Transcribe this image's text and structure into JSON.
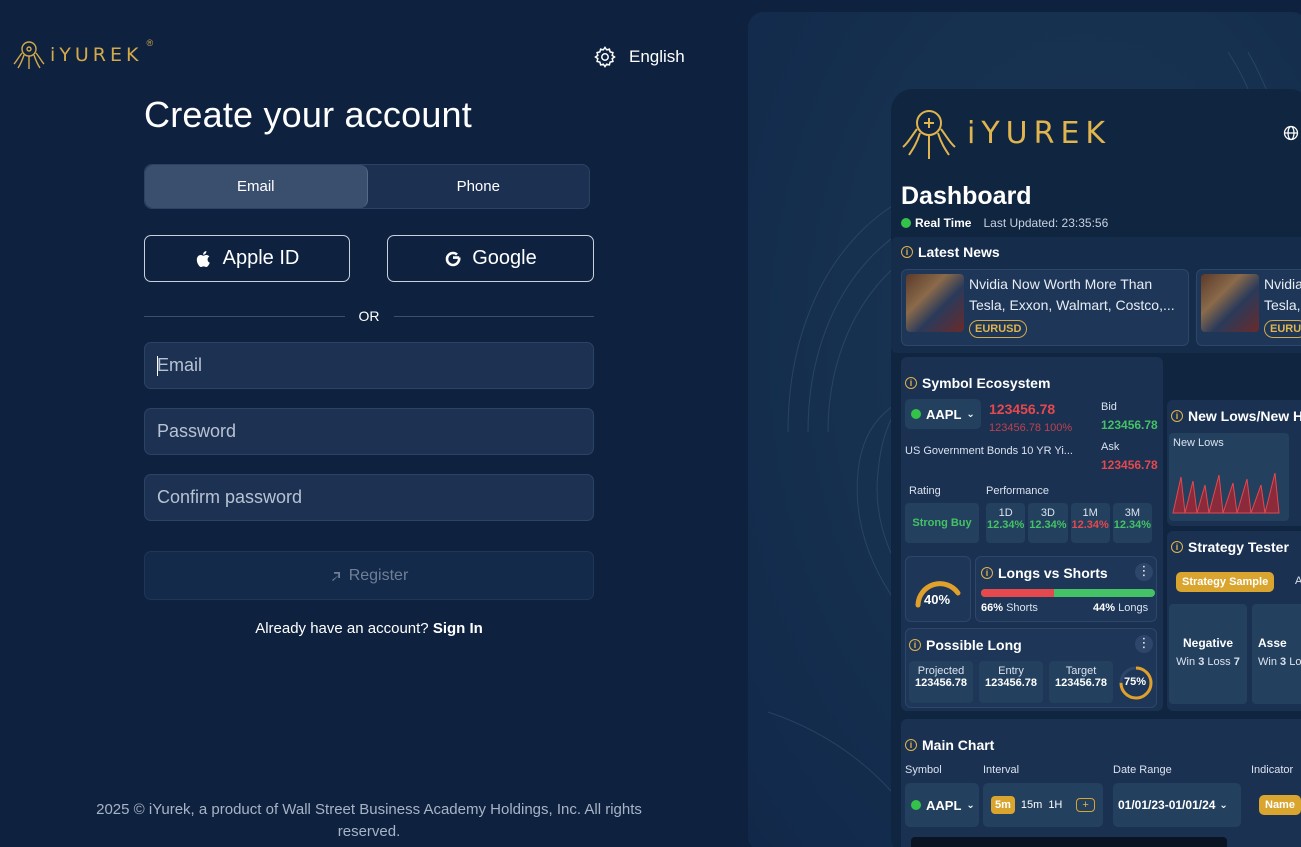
{
  "brand": {
    "name": "iYUREK",
    "trademark": "®",
    "gold": "#d4a94a"
  },
  "header": {
    "language": "English",
    "settings_icon": "gear-icon"
  },
  "form": {
    "title": "Create your account",
    "tabs": [
      {
        "label": "Email",
        "active": true
      },
      {
        "label": "Phone",
        "active": false
      }
    ],
    "apple_label": "Apple ID",
    "google_label": "Google",
    "or_label": "OR",
    "email_placeholder": "Email",
    "password_placeholder": "Password",
    "confirm_placeholder": "Confirm password",
    "register_label": "Register",
    "signin_prompt": "Already have an account?",
    "signin_link": "Sign In"
  },
  "footer": {
    "text": "2025 © iYurek, a product of Wall Street Business Academy Holdings, Inc. All rights reserved."
  },
  "dashboard": {
    "logo": "iYUREK",
    "title": "Dashboard",
    "realtime": "Real Time",
    "last_updated": "Last Updated: 23:35:56",
    "latest_news": "Latest News",
    "news": [
      {
        "line1": "Nvidia Now Worth More Than",
        "line2": "Tesla, Exxon, Walmart, Costco,...",
        "tag": "EURUSD"
      },
      {
        "line1": "Nvidia",
        "line2": "Tesla,",
        "tag": "EURU"
      }
    ],
    "symbol_ecosystem": "Symbol Ecosystem",
    "symbol": "AAPL",
    "price": "123456.78",
    "price_sub": "123456.78",
    "price_pct": "100%",
    "bid_label": "Bid",
    "bid": "123456.78",
    "ask_label": "Ask",
    "ask": "123456.78",
    "instrument": "US Government Bonds 10 YR Yi...",
    "rating_label": "Rating",
    "rating": "Strong Buy",
    "performance_label": "Performance",
    "performance": [
      {
        "period": "1D",
        "value": "12.34%",
        "dir": "up"
      },
      {
        "period": "3D",
        "value": "12.34%",
        "dir": "up"
      },
      {
        "period": "1M",
        "value": "12.34%",
        "dir": "down"
      },
      {
        "period": "3M",
        "value": "12.34%",
        "dir": "up"
      }
    ],
    "gauge": "40%",
    "longs_shorts": "Longs vs Shorts",
    "shorts": "66%",
    "shorts_label": "Shorts",
    "longs": "44%",
    "longs_label": "Longs",
    "possible_long": "Possible Long",
    "projected_label": "Projected",
    "projected": "123456.78",
    "entry_label": "Entry",
    "entry": "123456.78",
    "target_label": "Target",
    "target": "123456.78",
    "ring": "75%",
    "new_lows_title": "New Lows/New H",
    "new_lows_label": "New Lows",
    "strategy_tester": "Strategy Tester",
    "strategy_sample": "Strategy Sample",
    "strategy_extra": "A",
    "negative_label": "Negative",
    "asse_label": "Asse",
    "win_label": "Win",
    "win": "3",
    "loss_label": "Loss",
    "loss": "7",
    "win2": "3",
    "loss2_label": "Lo",
    "main_chart": "Main Chart",
    "symbol_label": "Symbol",
    "interval_label": "Interval",
    "intervals": [
      "5m",
      "15m",
      "1H"
    ],
    "plus": "+",
    "date_range_label": "Date Range",
    "date_range": "01/01/23-01/01/24",
    "indicator_label": "Indicator",
    "indicator_btn": "Name"
  }
}
